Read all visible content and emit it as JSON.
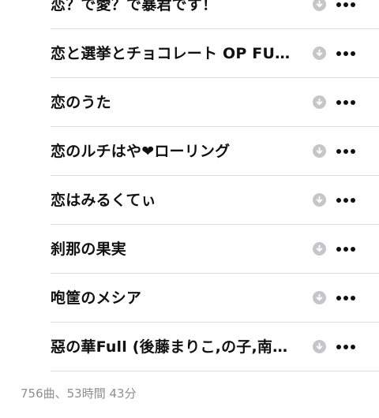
{
  "songs": [
    {
      "title": "恋？で愛？で暴君です！"
    },
    {
      "title": "恋と選挙とチョコレート OP FU…"
    },
    {
      "title": "恋のうた"
    },
    {
      "title": "恋のルチはや❤ローリング"
    },
    {
      "title": "恋はみるくてぃ"
    },
    {
      "title": "刹那の果実"
    },
    {
      "title": "咆筐のメシア"
    },
    {
      "title": "惡の華Full (後藤まりこ,の子,南…"
    }
  ],
  "icons": {
    "download": "download-circle-icon",
    "more": "more-ellipsis-icon"
  },
  "footer": {
    "summary": "756曲、53時間 43分"
  },
  "colors": {
    "text": "#111111",
    "secondary": "#8e8e93",
    "icon_gray": "#c6c6c8",
    "separator": "#dcdcde"
  }
}
